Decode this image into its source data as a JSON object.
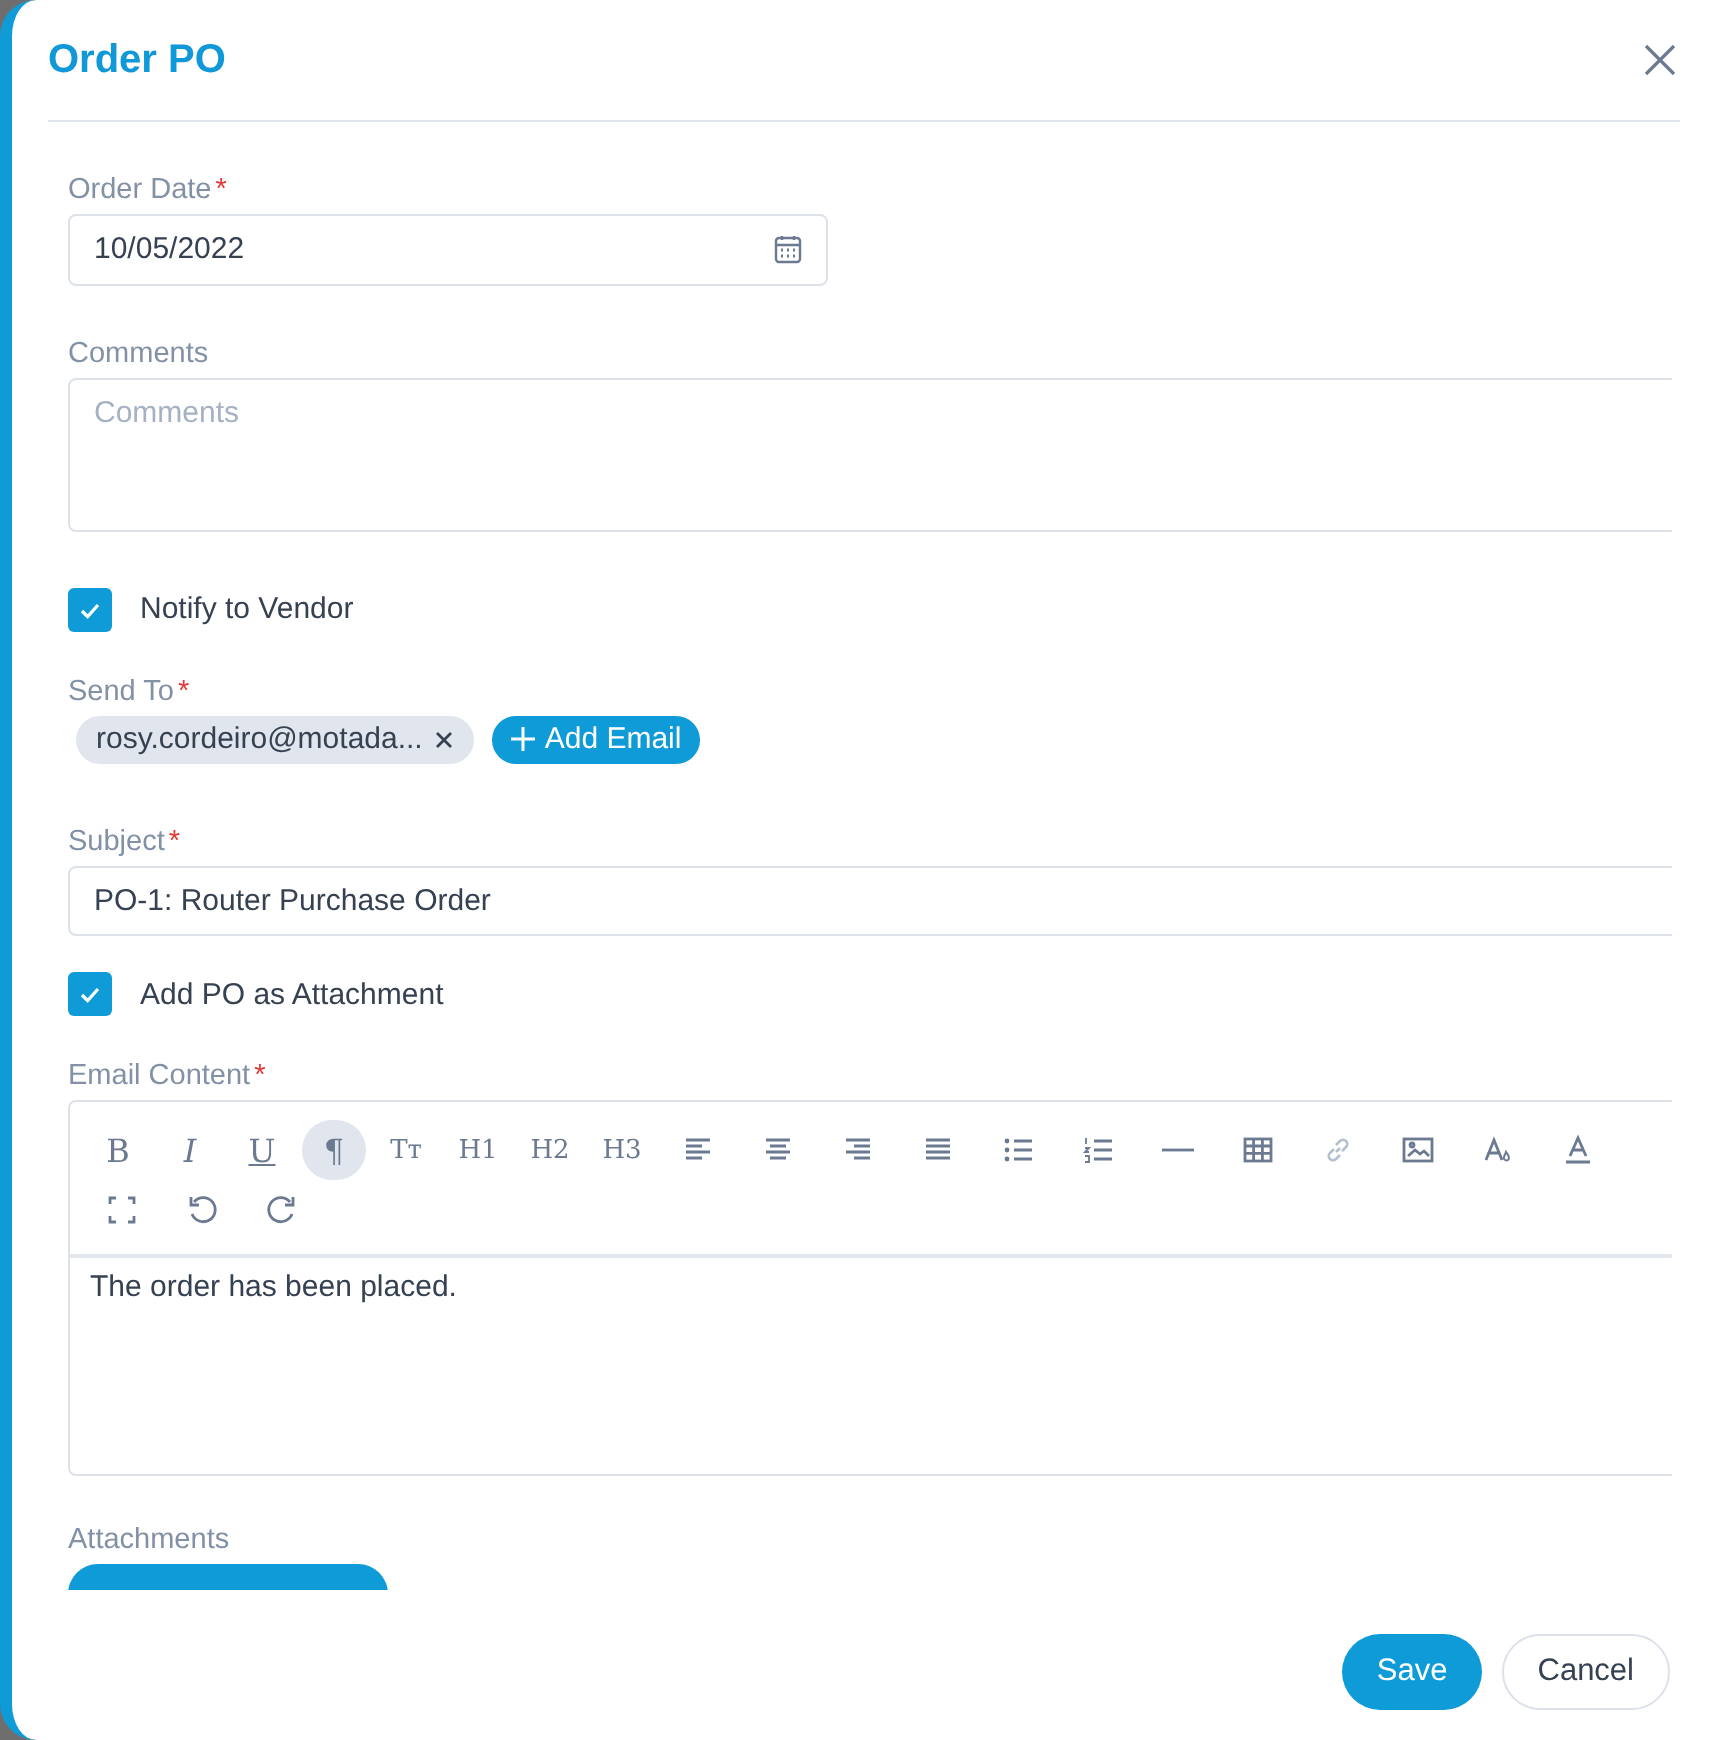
{
  "dialog": {
    "title": "Order PO"
  },
  "order_date": {
    "label": "Order Date",
    "required_mark": "*",
    "value": "10/05/2022"
  },
  "comments": {
    "label": "Comments",
    "placeholder": "Comments"
  },
  "notify_vendor": {
    "label": "Notify to Vendor",
    "checked": true
  },
  "send_to": {
    "label": "Send To",
    "required_mark": "*",
    "emails": [
      "rosy.cordeiro@motada..."
    ],
    "add_label": "Add Email"
  },
  "subject": {
    "label": "Subject",
    "required_mark": "*",
    "value": "PO-1: Router Purchase Order"
  },
  "attach_po": {
    "label": "Add PO as Attachment",
    "checked": true
  },
  "email_content": {
    "label": "Email Content",
    "required_mark": "*",
    "text_buttons": [
      {
        "label": "B",
        "selected": false
      },
      {
        "label": "I",
        "selected": false
      },
      {
        "label": "U",
        "selected": false
      },
      {
        "label": "¶",
        "selected": true
      },
      {
        "label": "Tт",
        "selected": false
      },
      {
        "label": "H1",
        "selected": false
      },
      {
        "label": "H2",
        "selected": false
      },
      {
        "label": "H3",
        "selected": false
      }
    ],
    "icon_buttons": [
      {
        "selected": false
      },
      {
        "selected": false
      },
      {
        "selected": false
      },
      {
        "selected": false
      },
      {
        "selected": false
      },
      {
        "selected": false
      },
      {
        "selected": false
      },
      {
        "selected": false
      },
      {
        "selected": false
      },
      {
        "selected": false
      },
      {
        "selected": false
      },
      {
        "selected": false
      },
      {
        "selected": false
      },
      {
        "selected": false
      },
      {
        "selected": false
      }
    ],
    "body": "The order has been placed."
  },
  "attachments": {
    "label": "Attachments"
  },
  "buttons": [
    {
      "label": "Save",
      "kind": "primary"
    },
    {
      "label": "Cancel",
      "kind": "secondary"
    }
  ]
}
